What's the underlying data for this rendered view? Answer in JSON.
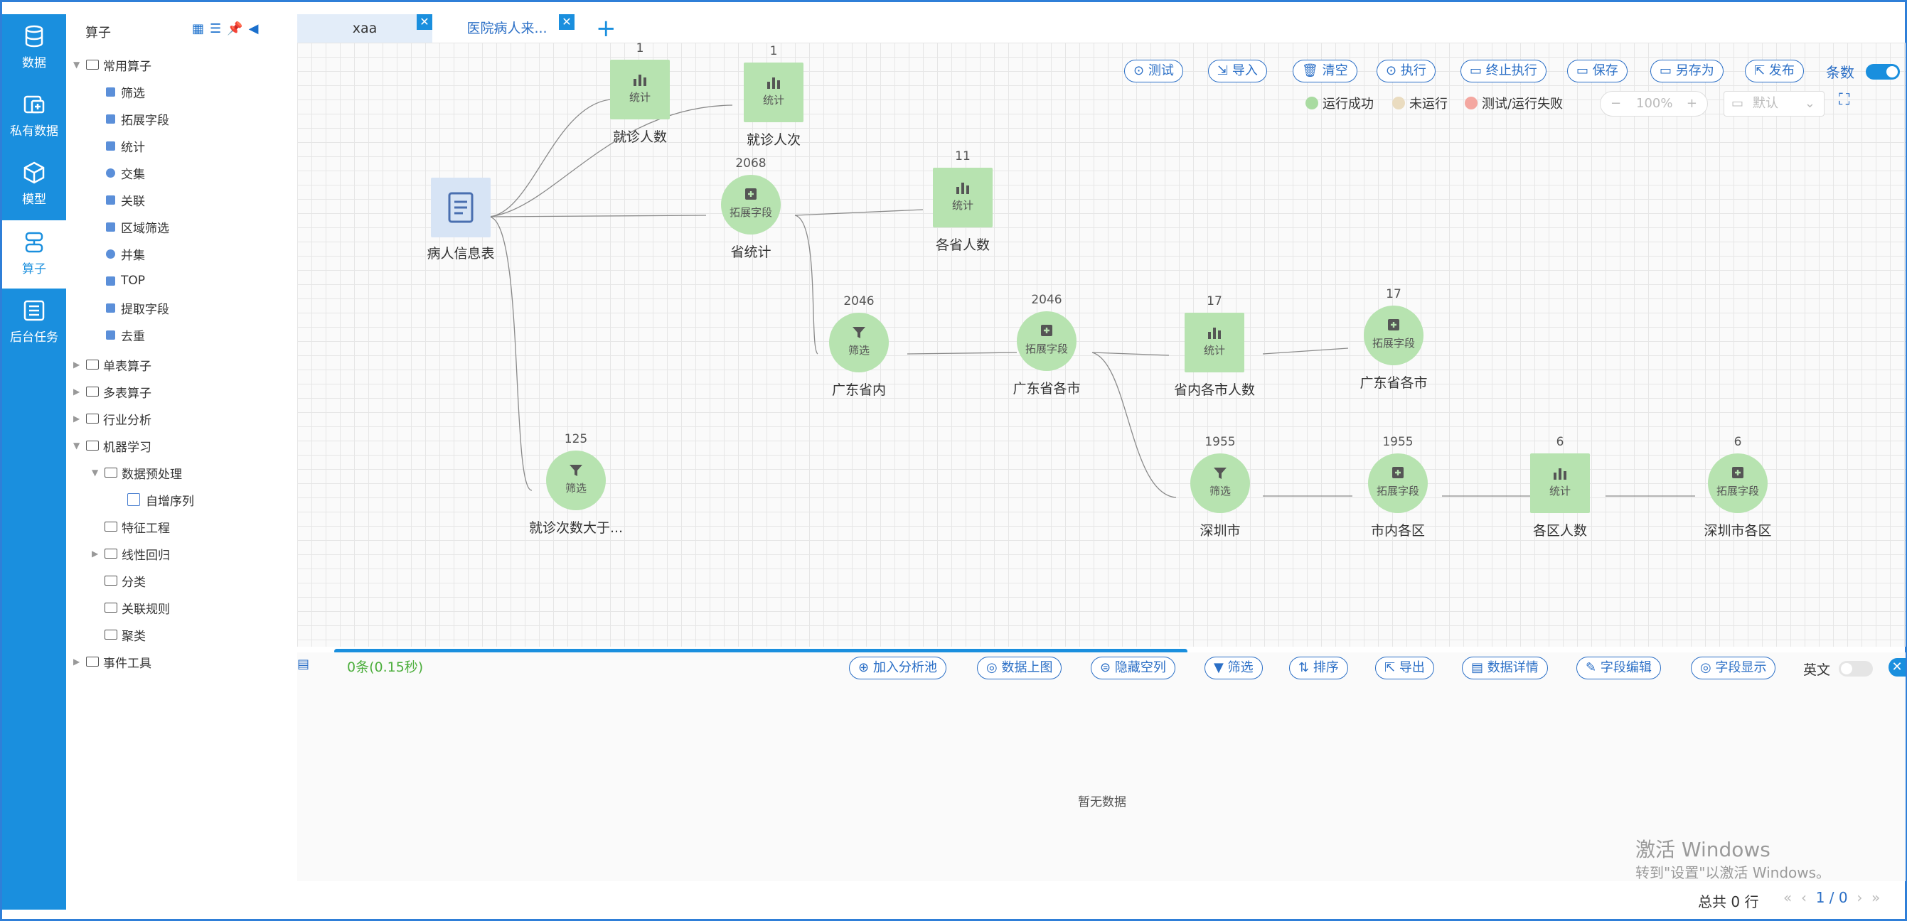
{
  "colors": {
    "nav_bg": "#1a8fde",
    "accent": "#2b6fc6",
    "node_fill": "#b7e3b0",
    "source_node_fill": "#d7e4f5",
    "status_success": "#a9dba1",
    "status_not_run": "#eadcc0",
    "status_failed": "#f4a7a0"
  },
  "nav": {
    "items": [
      {
        "label": "数据",
        "icon": "database-icon"
      },
      {
        "label": "私有数据",
        "icon": "private-data-icon"
      },
      {
        "label": "模型",
        "icon": "cube-icon"
      },
      {
        "label": "算子",
        "icon": "operator-icon",
        "active": true
      },
      {
        "label": "后台任务",
        "icon": "task-list-icon"
      }
    ]
  },
  "tree": {
    "title": "算子",
    "common_group": "常用算子",
    "common_items": [
      "筛选",
      "拓展字段",
      "统计",
      "交集",
      "关联",
      "区域筛选",
      "并集",
      "TOP",
      "提取字段",
      "去重"
    ],
    "single_table": "单表算子",
    "multi_table": "多表算子",
    "industry": "行业分析",
    "ml": "机器学习",
    "preprocess": "数据预处理",
    "auto_seq": "自增序列",
    "feature_eng": "特征工程",
    "linear_reg": "线性回归",
    "classify": "分类",
    "assoc_rules": "关联规则",
    "cluster": "聚类",
    "event_tools": "事件工具"
  },
  "tabs": [
    {
      "label": "xaa"
    },
    {
      "label": "医院病人来..."
    }
  ],
  "toolbar": {
    "test": "测试",
    "import": "导入",
    "clear": "清空",
    "execute": "执行",
    "stop": "终止执行",
    "save": "保存",
    "save_as": "另存为",
    "publish": "发布",
    "rows_label": "条数"
  },
  "legend": {
    "success": "运行成功",
    "not_run": "未运行",
    "failed": "测试/运行失败"
  },
  "zoom": {
    "minus": "−",
    "value": "100%",
    "plus": "+",
    "layout": "默认"
  },
  "nodes": {
    "source": {
      "name": "病人信息表"
    },
    "n1": {
      "count": "1",
      "label": "统计",
      "name": "就诊人数"
    },
    "n2": {
      "count": "1",
      "label": "统计",
      "name": "就诊人次"
    },
    "n3": {
      "count": "2068",
      "label": "拓展字段",
      "name": "省统计"
    },
    "n4": {
      "count": "11",
      "label": "统计",
      "name": "各省人数"
    },
    "n5": {
      "count": "2046",
      "label": "筛选",
      "name": "广东省内"
    },
    "n6": {
      "count": "2046",
      "label": "拓展字段",
      "name": "广东省各市"
    },
    "n7": {
      "count": "17",
      "label": "统计",
      "name": "省内各市人数"
    },
    "n8": {
      "count": "17",
      "label": "拓展字段",
      "name": "广东省各市"
    },
    "n9": {
      "count": "125",
      "label": "筛选",
      "name": "就诊次数大于..."
    },
    "n10": {
      "count": "1955",
      "label": "筛选",
      "name": "深圳市"
    },
    "n11": {
      "count": "1955",
      "label": "拓展字段",
      "name": "市内各区"
    },
    "n12": {
      "count": "6",
      "label": "统计",
      "name": "各区人数"
    },
    "n13": {
      "count": "6",
      "label": "拓展字段",
      "name": "深圳市各区"
    }
  },
  "result": {
    "status": "0条(0.15秒)",
    "add_pool": "加入分析池",
    "to_chart": "数据上图",
    "hide_empty": "隐藏空列",
    "filter": "筛选",
    "sort": "排序",
    "export": "导出",
    "detail": "数据详情",
    "edit_fields": "字段编辑",
    "show_fields": "字段显示",
    "english": "英文",
    "empty": "暂无数据",
    "total": "总共 0 行",
    "page": "1 / 0"
  },
  "watermark": {
    "line1": "激活 Windows",
    "line2": "转到\"设置\"以激活 Windows。"
  }
}
